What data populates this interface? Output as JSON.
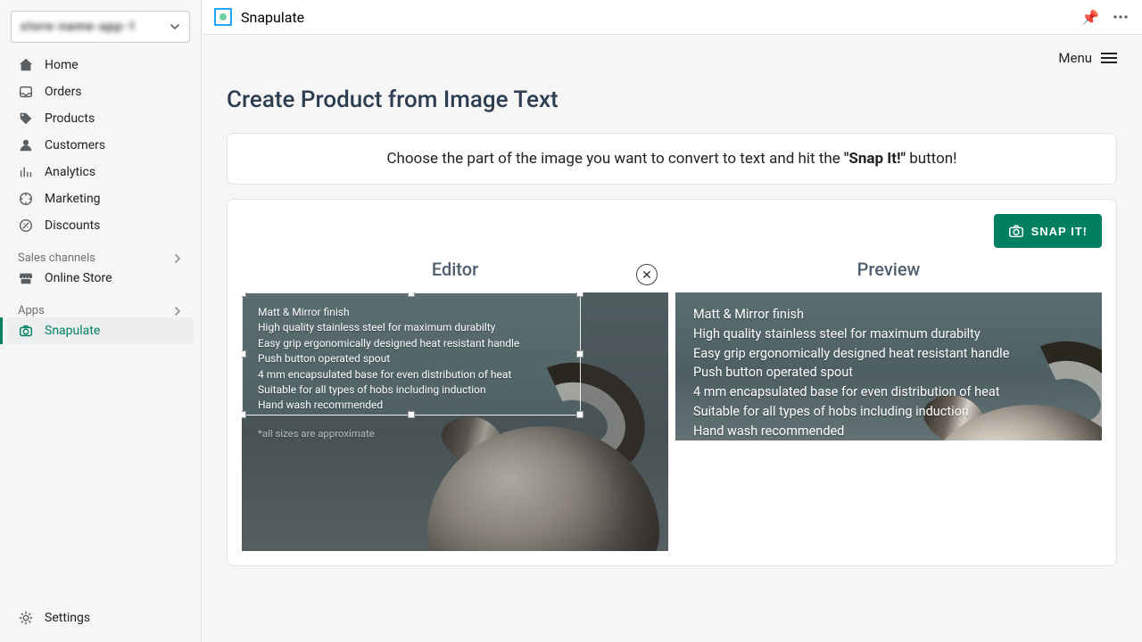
{
  "store_select": {
    "placeholder_blurred": "store-name-app-1"
  },
  "nav": {
    "home": "Home",
    "orders": "Orders",
    "products": "Products",
    "customers": "Customers",
    "analytics": "Analytics",
    "marketing": "Marketing",
    "discounts": "Discounts"
  },
  "sections": {
    "sales_channels": "Sales channels",
    "online_store": "Online Store",
    "apps": "Apps",
    "snapulate": "Snapulate"
  },
  "settings_label": "Settings",
  "topbar": {
    "app_name": "Snapulate"
  },
  "menubar": {
    "label": "Menu"
  },
  "page": {
    "title": "Create Product from Image Text",
    "banner_pre": "Choose the part of the image you want to convert to text and hit the ",
    "banner_bold": "\"Snap It!\"",
    "banner_post": " button!",
    "snap_button": "SNAP IT!",
    "editor_label": "Editor",
    "preview_label": "Preview"
  },
  "image_text": {
    "lines": [
      "Matt & Mirror finish",
      "High quality stainless steel for maximum durabilty",
      "Easy grip ergonomically designed heat resistant handle",
      "Push button operated spout",
      "4 mm encapsulated base for even distribution of heat",
      "Suitable for all types of hobs including induction",
      "Hand wash recommended"
    ],
    "note": "*all sizes are approximate"
  }
}
